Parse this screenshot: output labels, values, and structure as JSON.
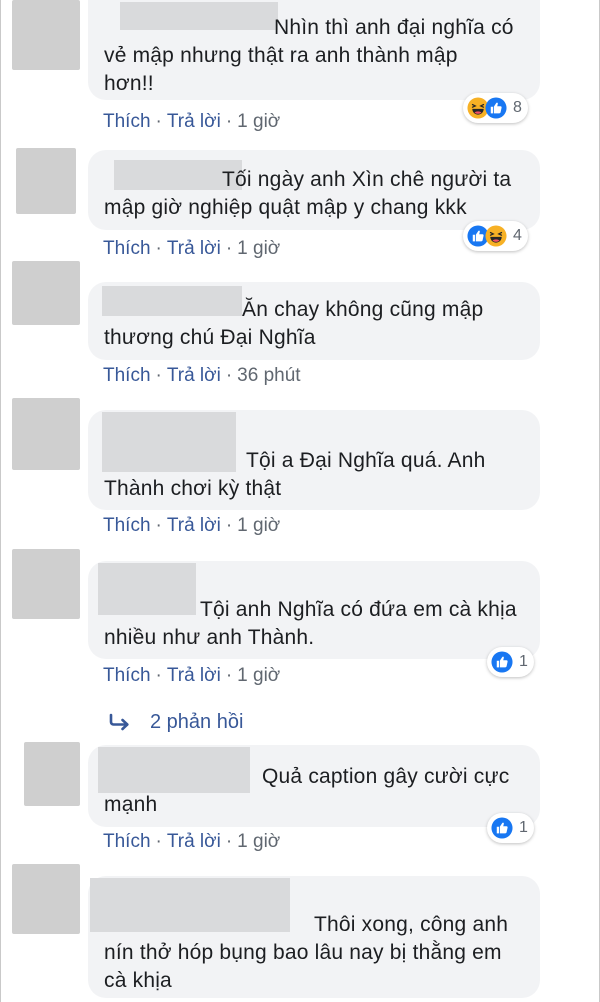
{
  "comments": [
    {
      "lines": [
        "Nhìn thì anh đại nghĩa có",
        "vẻ mập nhưng thật ra anh thành mập",
        "hơn!!"
      ],
      "actions": {
        "like": "Thích",
        "reply": "Trả lời",
        "time": "1 giờ"
      },
      "reactions": {
        "icons": [
          "haha-icon",
          "like-icon"
        ],
        "count": "8"
      }
    },
    {
      "lines": [
        "Tối ngày anh Xìn chê người ta",
        "mập giờ nghiệp quật mập y chang kkk"
      ],
      "actions": {
        "like": "Thích",
        "reply": "Trả lời",
        "time": "1 giờ"
      },
      "reactions": {
        "icons": [
          "like-icon",
          "haha-icon"
        ],
        "count": "4"
      }
    },
    {
      "lines": [
        "Ăn chay không cũng mập",
        "thương chú Đại Nghĩa"
      ],
      "actions": {
        "like": "Thích",
        "reply": "Trả lời",
        "time": "36 phút"
      }
    },
    {
      "lines": [
        "Tội a Đại Nghĩa quá. Anh",
        "Thành chơi kỳ thật"
      ],
      "actions": {
        "like": "Thích",
        "reply": "Trả lời",
        "time": "1 giờ"
      }
    },
    {
      "lines": [
        "Tội anh Nghĩa có đứa em cà khịa",
        "nhiều như anh Thành."
      ],
      "actions": {
        "like": "Thích",
        "reply": "Trả lời",
        "time": "1 giờ"
      },
      "reactions": {
        "icons": [
          "like-icon"
        ],
        "count": "1"
      },
      "replies_label": "2 phản hồi"
    },
    {
      "lines": [
        "Quả caption gây cười cực",
        "mạnh"
      ],
      "actions": {
        "like": "Thích",
        "reply": "Trả lời",
        "time": "1 giờ"
      },
      "reactions": {
        "icons": [
          "like-icon"
        ],
        "count": "1"
      }
    },
    {
      "lines": [
        "Thôi xong, công anh",
        "nín thở hóp bụng bao lâu nay bị thằng em",
        "cà khịa"
      ]
    }
  ],
  "colors": {
    "link": "#385898",
    "bubble": "#f2f3f5",
    "like_blue": "#1877f2",
    "haha_yellow": "#f7b125"
  }
}
